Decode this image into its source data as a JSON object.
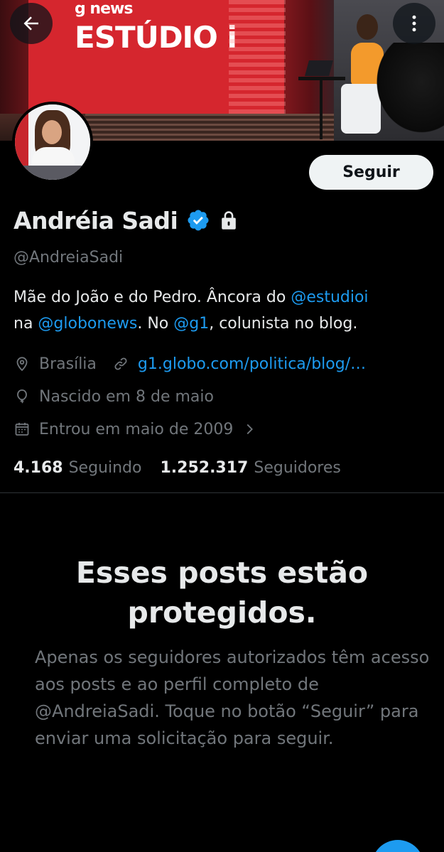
{
  "header": {
    "back_icon": "arrow-left-icon",
    "more_icon": "vertical-dots-icon",
    "banner": {
      "logo_small": "g news",
      "logo_big": "ESTÚDIO i"
    }
  },
  "profile": {
    "follow_label": "Seguir",
    "display_name": "Andréia Sadi",
    "verified_icon": "verified-badge-icon",
    "protected_icon": "lock-icon",
    "handle": "@AndreiaSadi",
    "bio": {
      "part1": "Mãe do João e do Pedro. Âncora do ",
      "mention1": "@estudioi",
      "part2": "na ",
      "mention2": "@globonews",
      "part3": ". No ",
      "mention3": "@g1",
      "part4": ", colunista no blog."
    },
    "location": "Brasília",
    "website": "g1.globo.com/politica/blog/…",
    "birthday": "Nascido em 8 de maio",
    "joined": "Entrou em maio de 2009",
    "following_count": "4.168",
    "following_label": "Seguindo",
    "followers_count": "1.252.317",
    "followers_label": "Seguidores"
  },
  "protected": {
    "title": "Esses posts estão protegidos.",
    "body": "Apenas os seguidores autorizados têm acesso aos posts e ao perfil completo de @AndreiaSadi. Toque no botão “Seguir” para enviar uma solicitação para seguir."
  },
  "colors": {
    "background": "#000000",
    "text_primary": "#e7e9ea",
    "text_secondary": "#71767b",
    "accent": "#1d9bf0",
    "button_bg": "#eff3f4"
  }
}
